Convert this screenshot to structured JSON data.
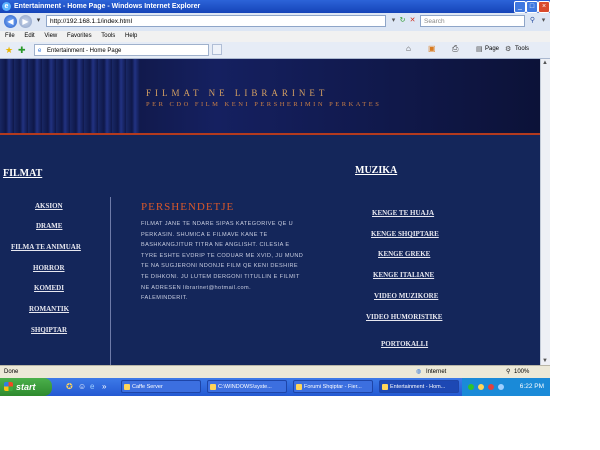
{
  "window": {
    "title": "Entertainment - Home Page - Windows Internet Explorer",
    "min": "_",
    "max": "□",
    "close": "×"
  },
  "address": {
    "url": "http://192.168.1.1/index.html",
    "search_placeholder": "Search"
  },
  "menu": [
    "File",
    "Edit",
    "View",
    "Favorites",
    "Tools",
    "Help"
  ],
  "tab": {
    "label": "Entertainment - Home Page",
    "commands": [
      "Page",
      "Tools"
    ]
  },
  "banner": {
    "title": "FILMAT NE LIBRARINET",
    "subtitle": "PER CDO FILM KENI PERSHERIMIN PERKATES"
  },
  "filmat": {
    "heading": "FILMAT",
    "items": [
      "AKSION",
      "DRAME",
      "FILMA TE ANIMUAR",
      "HORROR",
      "KOMEDI",
      "ROMANTIK",
      "SHQIPTAR"
    ]
  },
  "greeting": {
    "heading": "PERSHENDETJE",
    "lines": [
      "FILMAT JANE TE NDARE SIPAS KATEGORIVE QE U",
      "PERKASIN. SHUMICA E FILMAVE KANE TE",
      "BASHKANGJITUR TITRA NE ANGLISHT. CILESIA E",
      "TYRE ESHTE EVDRIP TE CODUAR ME XVID, JU MUND",
      "TE NA SUGJERONI NDONJE FILM QE KENI DESHIRE",
      "TE DIHKONI. JU LUTEM DERGONI TITULLIN E FILMIT",
      "NE ADRESEN librarinet@hotmail.com.",
      "FALEMINDERIT."
    ]
  },
  "muzika": {
    "heading": "MUZIKA",
    "items": [
      "KENGE TE HUAJA",
      "KENGE SHQIPTARE",
      "KENGE GREKE",
      "KENGE ITALIANE",
      "VIDEO MUZIKORE",
      "VIDEO HUMORISTIKE",
      "PORTOKALLI"
    ]
  },
  "status": {
    "left": "Done",
    "zone": "Internet",
    "zoom": "100%"
  },
  "taskbar": {
    "start": "start",
    "tasks": [
      "Caffe Server",
      "C:\\WINDOWS\\syste...",
      "Forumi Shqiptar - Fier...",
      "Entertainment - Hom..."
    ],
    "clock": "6:22 PM"
  },
  "colors": {
    "page_bg": "#14265a",
    "banner_text": "#d5a062",
    "greeting_heading": "#d9582a",
    "divider_red": "#b33a1e"
  }
}
